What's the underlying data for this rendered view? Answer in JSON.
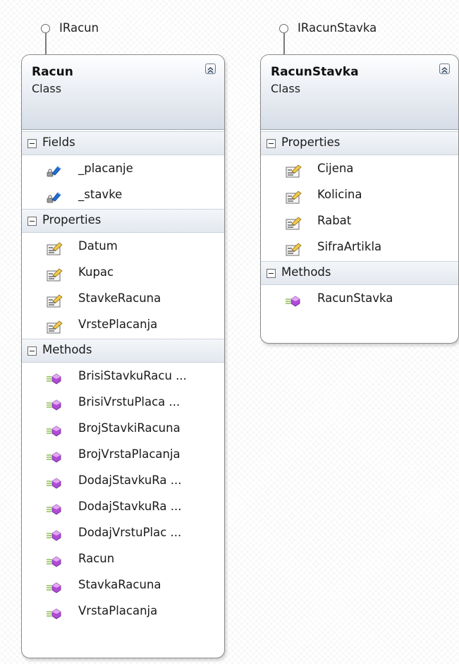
{
  "interfaces": [
    {
      "name": "IRacun"
    },
    {
      "name": "IRacunStavka"
    }
  ],
  "classes": [
    {
      "name": "Racun",
      "kind": "Class",
      "sections": [
        {
          "name": "Fields",
          "member_icon": "field-icon",
          "members": [
            "_placanje",
            "_stavke"
          ]
        },
        {
          "name": "Properties",
          "member_icon": "property-icon",
          "members": [
            "Datum",
            "Kupac",
            "StavkeRacuna",
            "VrstePlacanja"
          ]
        },
        {
          "name": "Methods",
          "member_icon": "method-icon",
          "members": [
            "BrisiStavkuRacu ...",
            "BrisiVrstuPlaca ...",
            "BrojStavkiRacuna",
            "BrojVrstaPlacanja",
            "DodajStavkuRa ...",
            "DodajStavkuRa ...",
            "DodajVrstuPlac ...",
            "Racun",
            "StavkaRacuna",
            "VrstaPlacanja"
          ]
        }
      ]
    },
    {
      "name": "RacunStavka",
      "kind": "Class",
      "sections": [
        {
          "name": "Properties",
          "member_icon": "property-icon",
          "members": [
            "Cijena",
            "Kolicina",
            "Rabat",
            "SifraArtikla"
          ]
        },
        {
          "name": "Methods",
          "member_icon": "method-icon",
          "members": [
            "RacunStavka"
          ]
        }
      ]
    }
  ],
  "colors": {
    "method_icon": "#b04bd6",
    "field_icon": "#1e6fd6",
    "property_icon": "#f2c94c"
  }
}
